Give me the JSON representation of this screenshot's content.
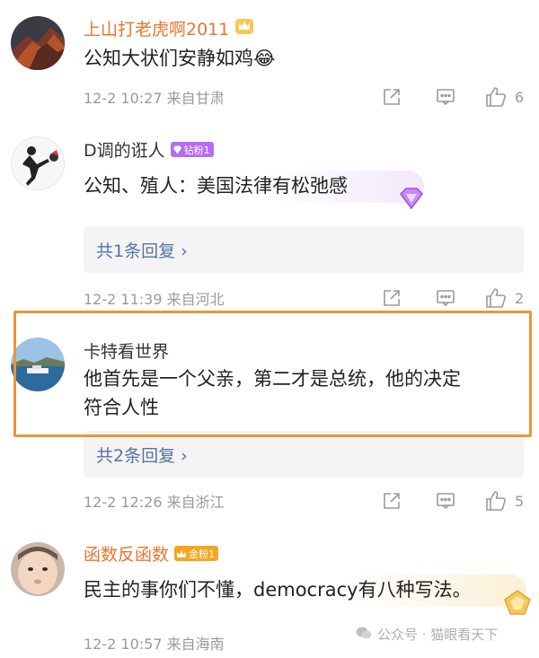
{
  "comments": [
    {
      "name": "上山打老虎啊2011",
      "text": "公知大状们安静如鸡😂",
      "time": "12-2 10:27 来自甘肃",
      "likes": "6"
    },
    {
      "name": "D调的诳人",
      "badge": "钻粉1",
      "text": "公知、殖人：美国法律有松弛感",
      "replies": "共1条回复 ›",
      "time": "12-2 11:39 来自河北",
      "likes": "2"
    },
    {
      "name": "卡特看世界",
      "text_line1": "他首先是一个父亲，第二才是总统，他的决定",
      "text_line2": "符合人性",
      "replies": "共2条回复 ›",
      "time": "12-2 12:26 来自浙江",
      "likes": "5"
    },
    {
      "name": "函数反函数",
      "badge": "金粉1",
      "text": "民主的事你们不懂，democracy有八种写法。",
      "time": "12-2 10:57 来自海南"
    }
  ],
  "watermark": "公众号 · 猫眼看天下",
  "colors": {
    "orange_name": "#e8762c",
    "link": "#5673a3",
    "highlight": "#e8963a"
  },
  "icons": [
    "share-icon",
    "comment-icon",
    "like-icon",
    "crown-icon",
    "diamond-icon"
  ]
}
